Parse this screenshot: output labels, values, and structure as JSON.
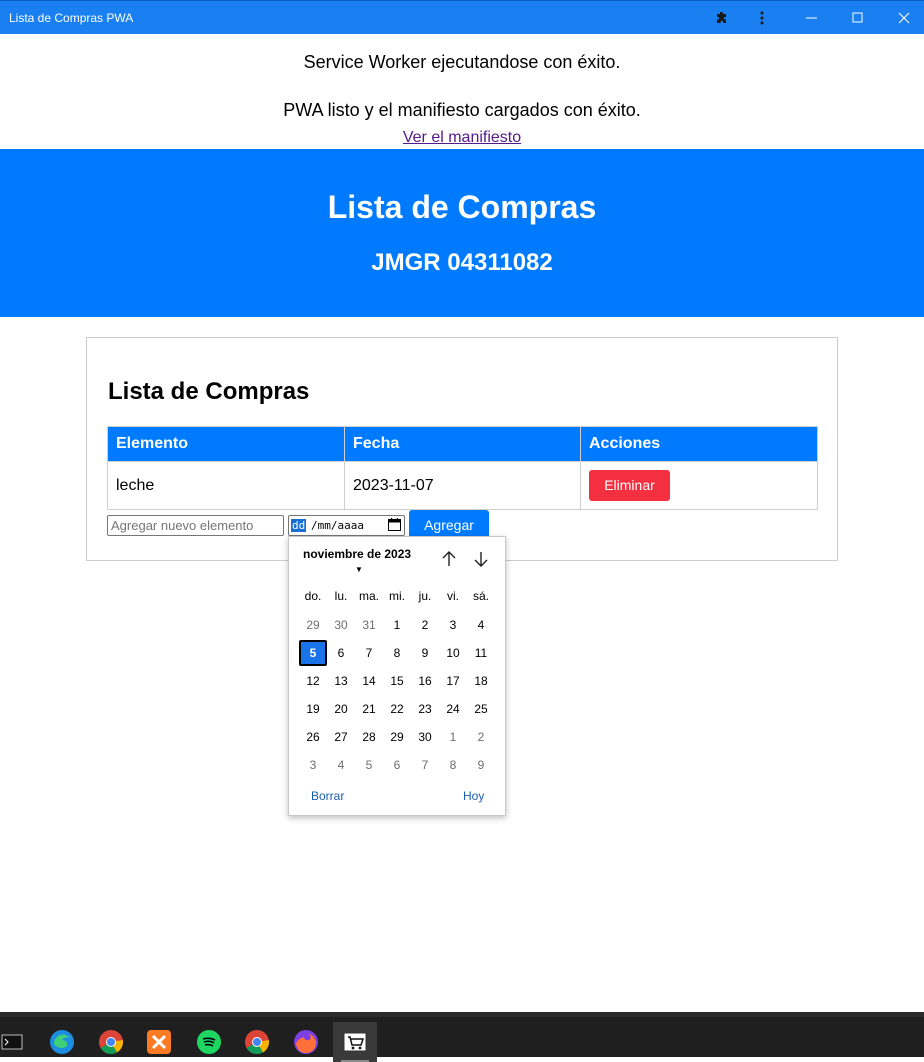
{
  "window": {
    "title": "Lista de Compras PWA"
  },
  "messages": {
    "service_worker": "Service Worker ejecutandose con éxito.",
    "manifest": "PWA listo y el manifiesto cargados con éxito.",
    "manifest_link": "Ver el manifiesto"
  },
  "header": {
    "title": "Lista de Compras",
    "subtitle": "JMGR 04311082"
  },
  "card": {
    "title": "Lista de Compras",
    "columns": [
      "Elemento",
      "Fecha",
      "Acciones"
    ],
    "rows": [
      {
        "item": "leche",
        "date": "2023-11-07",
        "action": "Eliminar"
      }
    ]
  },
  "form": {
    "item_placeholder": "Agregar nuevo elemento",
    "date_day": "dd",
    "date_rest": "/mm/aaaa",
    "add_label": "Agregar"
  },
  "calendar": {
    "month_label": "noviembre de 2023",
    "weekdays": [
      "do.",
      "lu.",
      "ma.",
      "mi.",
      "ju.",
      "vi.",
      "sá."
    ],
    "weeks": [
      [
        "29",
        "30",
        "31",
        "1",
        "2",
        "3",
        "4"
      ],
      [
        "5",
        "6",
        "7",
        "8",
        "9",
        "10",
        "11"
      ],
      [
        "12",
        "13",
        "14",
        "15",
        "16",
        "17",
        "18"
      ],
      [
        "19",
        "20",
        "21",
        "22",
        "23",
        "24",
        "25"
      ],
      [
        "26",
        "27",
        "28",
        "29",
        "30",
        "1",
        "2"
      ],
      [
        "3",
        "4",
        "5",
        "6",
        "7",
        "8",
        "9"
      ]
    ],
    "selected_day": "5",
    "clear_label": "Borrar",
    "today_label": "Hoy"
  },
  "colors": {
    "accent": "#007bff",
    "titlebar": "#1a7ff0",
    "danger": "#f43040"
  },
  "taskbar": {
    "apps": [
      "terminal-icon",
      "edge-icon",
      "chrome-icon",
      "xampp-icon",
      "spotify-icon",
      "chrome-profile-icon",
      "firefox-icon",
      "shopping-cart-app-icon"
    ]
  }
}
